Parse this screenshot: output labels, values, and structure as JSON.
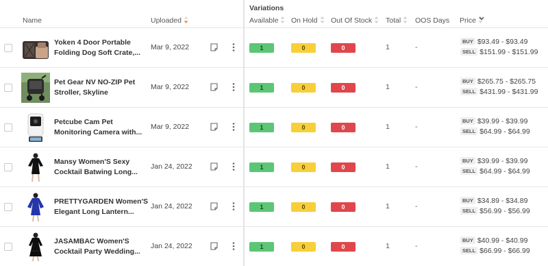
{
  "header": {
    "name": "Name",
    "uploaded": "Uploaded",
    "variations": "Variations",
    "available": "Available",
    "on_hold": "On Hold",
    "out_of_stock": "Out Of Stock",
    "total": "Total",
    "oos_days": "OOS Days",
    "price": "Price"
  },
  "colors": {
    "available": "#5cc676",
    "on_hold": "#f7cf3b",
    "out_of_stock": "#e0474c",
    "sort_active": "#f0873b"
  },
  "rows": [
    {
      "title1": "Yoken 4 Door Portable",
      "title2": "Folding Dog Soft Crate,...",
      "date": "Mar 9, 2022",
      "available": "1",
      "on_hold": "0",
      "out_of_stock": "0",
      "total": "1",
      "oos_days": "-",
      "buy_tag": "BUY",
      "buy": "$93.49 - $93.49",
      "sell_tag": "SELL",
      "sell": "$151.99 - $151.99",
      "thumb": "dog-crate"
    },
    {
      "title1": "Pet Gear NV NO-ZIP Pet",
      "title2": "Stroller, Skyline",
      "date": "Mar 9, 2022",
      "available": "1",
      "on_hold": "0",
      "out_of_stock": "0",
      "total": "1",
      "oos_days": "-",
      "buy_tag": "BUY",
      "buy": "$265.75 - $265.75",
      "sell_tag": "SELL",
      "sell": "$431.99 - $431.99",
      "thumb": "pet-stroller"
    },
    {
      "title1": "Petcube Cam Pet",
      "title2": "Monitoring Camera with...",
      "date": "Mar 9, 2022",
      "available": "1",
      "on_hold": "0",
      "out_of_stock": "0",
      "total": "1",
      "oos_days": "-",
      "buy_tag": "BUY",
      "buy": "$39.99 - $39.99",
      "sell_tag": "SELL",
      "sell": "$64.99 - $64.99",
      "thumb": "pet-camera"
    },
    {
      "title1": "Mansy Women'S Sexy",
      "title2": "Cocktail Batwing Long...",
      "date": "Jan 24, 2022",
      "available": "1",
      "on_hold": "0",
      "out_of_stock": "0",
      "total": "1",
      "oos_days": "-",
      "buy_tag": "BUY",
      "buy": "$39.99 - $39.99",
      "sell_tag": "SELL",
      "sell": "$64.99 - $64.99",
      "thumb": "black-dress"
    },
    {
      "title1": "PRETTYGARDEN Women'S",
      "title2": "Elegant Long Lantern...",
      "date": "Jan 24, 2022",
      "available": "1",
      "on_hold": "0",
      "out_of_stock": "0",
      "total": "1",
      "oos_days": "-",
      "buy_tag": "BUY",
      "buy": "$34.89 - $34.89",
      "sell_tag": "SELL",
      "sell": "$56.99 - $56.99",
      "thumb": "blue-dress"
    },
    {
      "title1": "JASAMBAC Women'S",
      "title2": "Cocktail Party Wedding...",
      "date": "Jan 24, 2022",
      "available": "1",
      "on_hold": "0",
      "out_of_stock": "0",
      "total": "1",
      "oos_days": "-",
      "buy_tag": "BUY",
      "buy": "$40.99 - $40.99",
      "sell_tag": "SELL",
      "sell": "$66.99 - $66.99",
      "thumb": "black-lace-dress"
    }
  ]
}
